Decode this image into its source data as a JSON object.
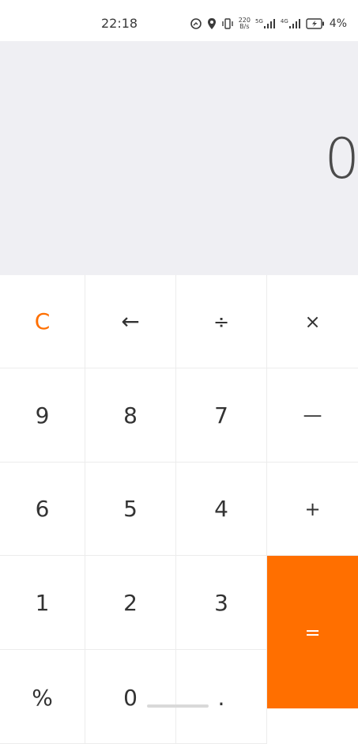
{
  "status_bar": {
    "time": "22:18",
    "net_speed_value": "220",
    "net_speed_unit": "B/s",
    "sim1_label": "5G",
    "sim2_label": "4G",
    "battery_percent": "4%"
  },
  "display": {
    "value": "0"
  },
  "keys": {
    "clear": "C",
    "backspace": "←",
    "divide": "÷",
    "multiply": "×",
    "nine": "9",
    "eight": "8",
    "seven": "7",
    "minus": "—",
    "six": "6",
    "five": "5",
    "four": "4",
    "plus": "+",
    "one": "1",
    "two": "2",
    "three": "3",
    "equals": "=",
    "percent": "%",
    "zero": "0",
    "decimal": "."
  },
  "colors": {
    "accent": "#ff6f00",
    "display_bg": "#efeff3",
    "key_text": "#333333"
  }
}
